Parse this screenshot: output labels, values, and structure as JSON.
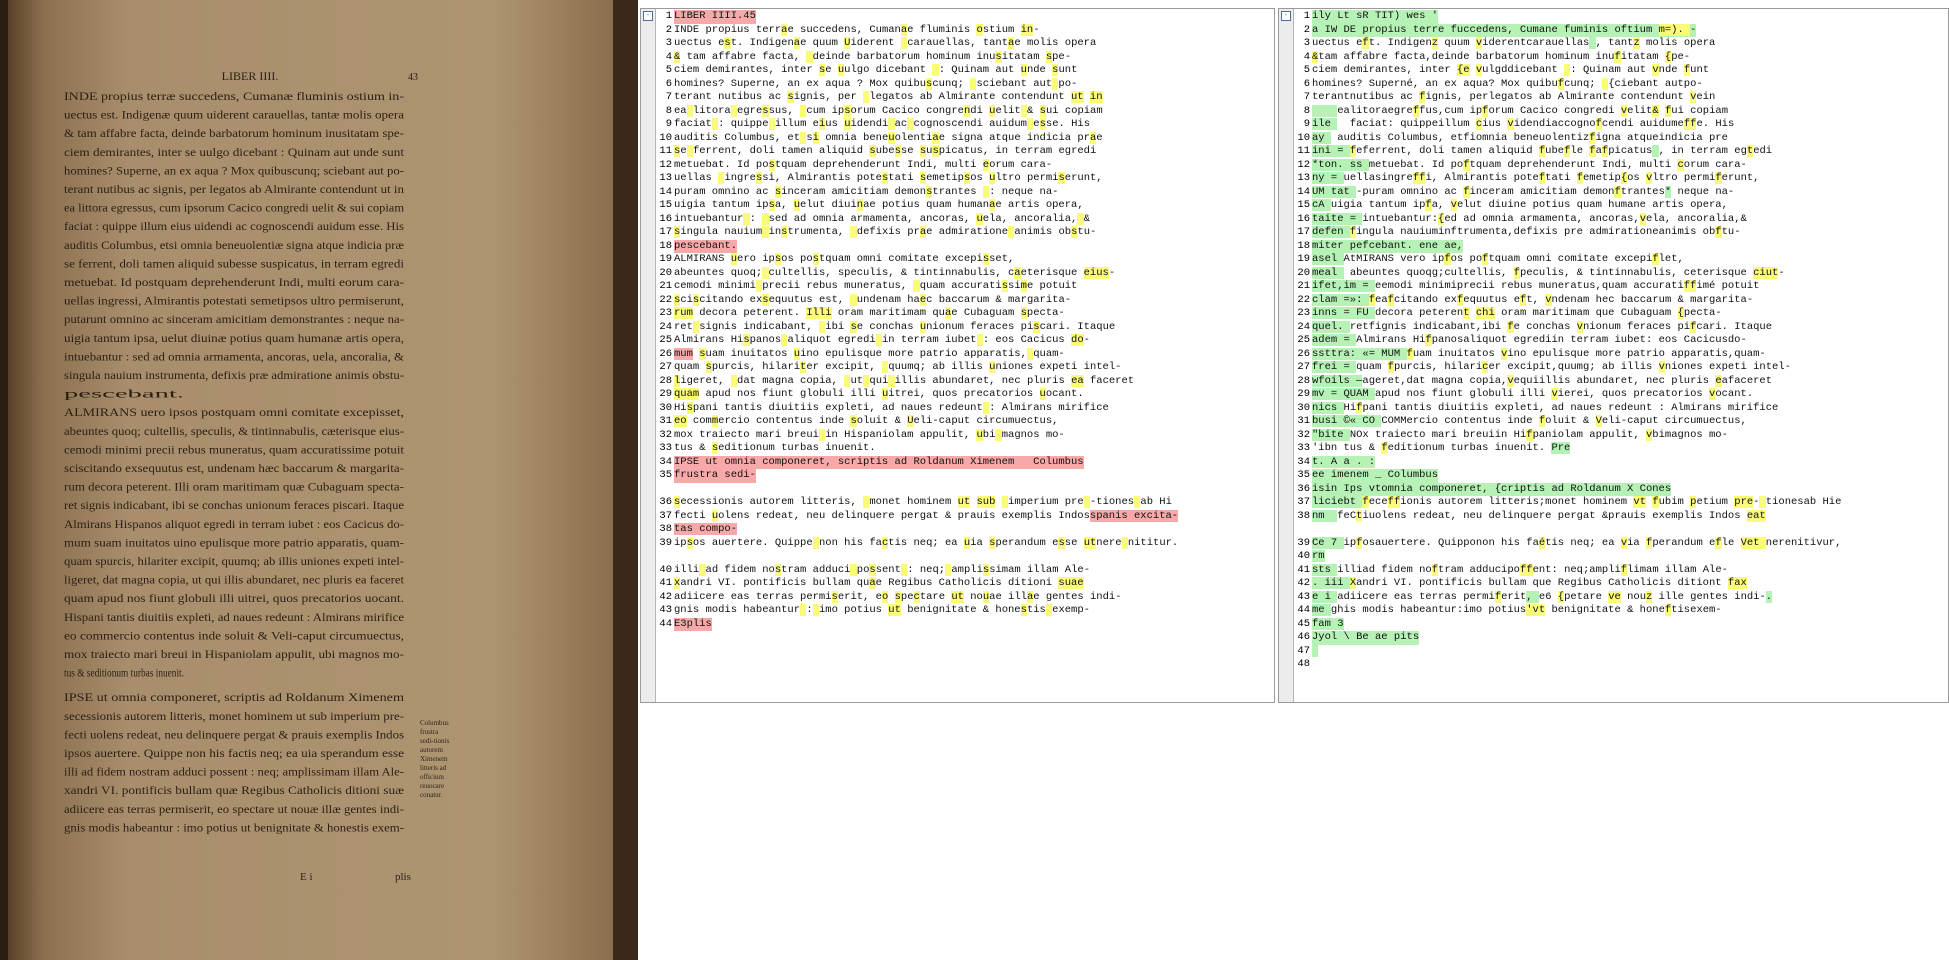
{
  "app": {
    "accent_colors": {
      "diff_word": "#fbfb7a",
      "removed_line": "#f7a8a8",
      "added_line": "#b6f2b6"
    }
  },
  "scan": {
    "lines": [
      "LIBER IIII.",
      "INDE propius terræ succedens, Cumanæ fluminis ostium in-",
      "uectus est. Indigenæ quum uiderent carauellas, tantæ molis opera",
      "& tam affabre facta, deinde barbatorum hominum inusitatam spe-",
      "ciem demirantes, inter se uulgo dicebant : Quinam aut unde sunt",
      "homines? Superne, an ex aqua ? Mox quibuscunq; sciebant aut po-",
      "terant nutibus ac signis, per legatos ab Almirante contendunt ut in",
      "ea littora egressus, cum ipsorum Cacico congredi uelit & sui copiam",
      "faciat : quippe illum eius uidendi ac cognoscendi auidum esse. His",
      "auditis Columbus, etsi omnia beneuolentiæ signa atque indicia præ",
      "se ferrent, doli tamen aliquid subesse suspicatus, in terram egredi",
      "metuebat. Id postquam deprehenderunt Indi, multi eorum cara-",
      "uellas ingressi, Almirantis potestati semetipsos ultro permiserunt,",
      "putarunt omnino ac sinceram amicitiam demonstrantes : neque na-",
      "uigia tantum ipsa, uelut diuinæ potius quam humanæ artis opera,",
      "intuebantur : sed ad omnia armamenta, ancoras, uela, ancoralia, &",
      "singula nauium instrumenta, defixis præ admiratione animis obstu-",
      "pescebant.",
      "ALMIRANS uero ipsos postquam omni comitate excepisset,",
      "abeuntes quoq; cultellis, speculis, & tintinnabulis, cæterisque eius-",
      "cemodi minimi precii rebus muneratus, quam accuratissime potuit",
      "sciscitando exsequutus est, undenam hæc baccarum & margarita-",
      "rum decora peterent. Illi oram maritimam quæ Cubaguam specta-",
      "ret signis indicabant, ibi se conchas unionum feraces piscari. Itaque",
      "Almirans Hispanos aliquot egredi in terram iubet : eos Cacicus do-",
      "mum suam inuitatos uino epulisque more patrio apparatis, quam-",
      "quam spurcis, hilariter excipit, quumq; ab illis uniones expeti intel-",
      "ligeret, dat magna copia, ut qui illis abundaret, nec pluris ea faceret",
      "quam apud nos fiunt globuli illi uitrei, quos precatorios uocant.",
      "Hispani tantis diuitiis expleti, ad naues redeunt : Almirans mirifice",
      "eo commercio contentus inde soluit & Veli-caput circumuectus,",
      "mox traiecto mari breui in Hispaniolam appulit, ubi magnos mo-",
      "tus & seditionum turbas inuenit.",
      "IPSE ut omnia componeret, scriptis ad Roldanum Ximenem",
      "secessionis autorem litteris, monet hominem ut sub imperium pre-",
      "fecti uolens redeat, neu delinquere pergat & prauis exemplis Indos",
      "ipsos auertere. Quippe non his factis neq; ea uia sperandum esse",
      "illi ad fidem nostram adduci possent : neq; amplissimam illam Ale-",
      "xandri VI. pontificis bullam quæ Regibus Catholicis ditioni suæ",
      "adiicere eas terras permiserit, eo spectare ut nouæ illæ gentes indi-",
      "gnis modis habeantur : imo potius ut benignitate & honestis exem-"
    ],
    "page_number": "43",
    "catchword": "plis",
    "signature": "E i",
    "margin_note": "Columbus frustra sedi-tionis autorem Ximenem litteris ad officium reuocare conatur."
  },
  "left_pane": {
    "fold": "-",
    "rows": [
      {
        "n": "1",
        "t": "LIBER IIII.45",
        "hl": "red"
      },
      {
        "n": "2",
        "t": "INDE propius terr[y:a]e succedens, Cuman[y:a]e fluminis [y:o]stium [y:in]-"
      },
      {
        "n": "3",
        "t": "uectus e[y:s]t. Indigen[y:a]e quum [y:U]iderent [y: ]carauellas, tant[y:a]e molis opera"
      },
      {
        "n": "4",
        "t": "[y:&] tam affabre facta, [y: ]deinde barbatorum hominum inu[y:s]itatam [y:s]pe-"
      },
      {
        "n": "5",
        "t": "ciem demirantes, inter [y:s]e [y:u]ulgo dicebant [y: ]: Quinam aut [y:u]nde [y:s]unt"
      },
      {
        "n": "6",
        "t": "homines? Superne, an ex aqua ? Mox quibu[y:s]cunq; [y: ]sciebant aut[y: ]po-"
      },
      {
        "n": "7",
        "t": "terant nutibus ac [y:s]ignis, per [y: ]legatos ab Almirante contendunt [y:ut] [y:in]"
      },
      {
        "n": "8",
        "t": "ea[y: ]litora[y: ]egre[y:s]sus, [y: ]cum ip[y:s]orum Cacico congre[y:n]di [y:u]elit[y: ]& [y:s]ui copiam"
      },
      {
        "n": "9",
        "t": "faciat[y: ]: quippe[y: ]illum e[y:i]us [y:u]idendi[y: ]ac[y: ]cognoscendi auidum[y: ]e[y:s]se. His"
      },
      {
        "n": "10",
        "t": "auditis Columbus, et[y: ]s[y:i] omnia bene[y:u]olenti[y:a]e signa atque indicia pr[y:a]e"
      },
      {
        "n": "11",
        "t": "[y:s]e[y: ]ferrent, doli tamen aliquid [y:s]ube[y:s]se [y:s]u[y:s]picatus, in terram egredi"
      },
      {
        "n": "12",
        "t": "metuebat. Id po[y:s]tquam deprehenderunt Indi, multi [y:e]orum cara-"
      },
      {
        "n": "13",
        "t": "uellas [y: ]ingre[y:s]si, Almirantis pote[y:s]tati [y:s]emetip[y:s]os [y:u]ltro permi[y:s]erunt,"
      },
      {
        "n": "14",
        "t": "puram omnino ac [y:s]inceram amicitiam demon[y:s]trantes [y: ]: neque na-"
      },
      {
        "n": "15",
        "t": "uigia tantum ip[y:s]a, [y:u]elut diui[y:n]ae potius quam human[y:a]e artis opera,"
      },
      {
        "n": "16",
        "t": "intuebantur[y: ]: [y: ]sed ad omnia armamenta, ancoras, [y:u]ela, ancoralia,[y: ]&"
      },
      {
        "n": "17",
        "t": "[y:s]ingula nauium[y: ]in[y:s]trumenta, [y: ]defixis pr[y:a]e admiratione[y: ]animis ob[y:s]tu-"
      },
      {
        "n": "18",
        "t": "pescebant.",
        "hl": "red"
      },
      {
        "n": "19",
        "t": "ALMIRANS [y:u]ero ip[y:s]os po[y:s]tquam omni comitate excepi[y:s]set,"
      },
      {
        "n": "20",
        "t": "abeuntes quoq;[y: ]cultellis, speculis, & tintinnabulis, c[y:a]eterisque [y:eius]-"
      },
      {
        "n": "21",
        "t": "cemodi minimi[y: ]precii rebus muneratus, [y: ]quam accurati[y:s]si[y:m]e potuit"
      },
      {
        "n": "22",
        "t": "[y:s]ci[y:s]citando ex[y:s]equutus est, [y: ]undenam ha[y:e]c baccarum & margarita-"
      },
      {
        "n": "23",
        "t": "[y:rum] decora peterent. [y:Illi] oram maritimam qu[y:a]e Cubaguam [y:s]pecta-"
      },
      {
        "n": "24",
        "t": "ret[y: ]signis indicabant, [y: ]ibi [y:s]e conchas [y:u]nionum feraces pi[y:s]cari. Itaque"
      },
      {
        "n": "25",
        "t": "Almirans Hi[y:s]panos[y: ]aliquot egredi[y: ]in terram iubet[y: ]: eos Cacicus [y:do]-"
      },
      {
        "n": "26",
        "t": "[r:mum] [y:s]uam inuitatos [y:u]ino epulisque more patrio apparatis,[y: ]quam-"
      },
      {
        "n": "27",
        "t": "quam [y:s]purcis, hilari[y:t]er excipit, [y: ]quumq; ab illis [y:u]niones expeti intel-"
      },
      {
        "n": "28",
        "t": "[y:l]igeret, [y: ]dat magna copia, [y: ]ut[y: ]qui[y: ]illis abundaret, nec pluris [y:ea] faceret"
      },
      {
        "n": "29",
        "t": "[y:quam] apud nos fiunt globuli illi [y:u]itrei, quos precatorios [y:u]ocant."
      },
      {
        "n": "30",
        "t": "Hi[y:s]pani tantis diuitiis expleti, ad naues redeunt[y: ]: Almirans mirifice"
      },
      {
        "n": "31",
        "t": "[y:eo] com[y:m]ercio contentus inde [y:s]oluit & [y:U]eli-caput circumuectus,"
      },
      {
        "n": "32",
        "t": "mox traiecto mari breui[y: ]in Hispaniolam appulit, [y:u]bi[y: ]magnos mo-"
      },
      {
        "n": "33",
        "t": "tus & [y:s]editionum turbas inuenit."
      },
      {
        "n": "34",
        "t": "IPSE ut omnia componeret, scriptis ad Roldanum Ximenem   Columbus",
        "hl": "red"
      },
      {
        "n": "35",
        "t": "frustra sedi-",
        "hl": "red"
      },
      {
        "n": "",
        "t": ""
      },
      {
        "n": "36",
        "t": "[y:s]ecessionis autorem litteris, [y: ]monet hominem [y:ut] [y:sub] [y: ]imperium pre[y: ]-tiones[y: ]ab Hi"
      },
      {
        "n": "37",
        "t": "fecti [y:u]olens redeat, neu delinquere pergat & prauis exemplis Indos[r:spanis excita-]"
      },
      {
        "n": "38",
        "t": "[r:tas compo-]"
      },
      {
        "n": "39",
        "t": "ip[y:s]os auertere. Quippe[y: ]non his fa[y:c]tis neq; ea [y:u]ia [y:s]perandum e[y:s]se [y:ut]nere[y: ]nititur."
      },
      {
        "n": "",
        "t": ""
      },
      {
        "n": "40",
        "t": "illi[y: ]ad fidem no[y:s]tram adduci[y: ]po[y:s]sent[y: ]: neq;[y: ]ampli[y:s]simam illam Ale-"
      },
      {
        "n": "41",
        "t": "[y:x]andri VI. pontificis bullam qu[y:a]e Regibus Catholicis ditioni [y:suae]"
      },
      {
        "n": "42",
        "t": "adiicere eas terras permi[y:s]erit, e[y:o] [y:s]pe[y:c]tare [y:ut] no[y:u]ae ill[y:a]e gentes indi-"
      },
      {
        "n": "43",
        "t": "gnis modis habeantur[y: ]:[y: ]imo potius [y:ut] benignitate & hone[y:s]tis[y: ]exemp-"
      },
      {
        "n": "44",
        "t": "E3plis",
        "hl": "red"
      }
    ]
  },
  "right_pane": {
    "fold": "-",
    "rows": [
      {
        "n": "1",
        "t": "ily Lt sR TIT) wes '",
        "hl": "grn"
      },
      {
        "n": "2",
        "t": "a IW DE propius terre fuccedens, Cumane fuminis oftium [y:m=). ]-",
        "hl": "grn"
      },
      {
        "n": "3",
        "t": "uectus e[y:f]t. Indigen[y:z] quum [y:v]iderentcarauellas[g: ], tant[y:z] molis opera"
      },
      {
        "n": "4",
        "t": "[y:&]tam affabre facta,deinde barbatorum hominum inu[y:f]itatam [y:{]pe-"
      },
      {
        "n": "5",
        "t": "ciem demirantes, inter [y:{e] [y:v]ulgddicebant [y: ]: Quinam aut [y:v]nde [y:f]unt"
      },
      {
        "n": "6",
        "t": "homines? Superné, an ex aqua? Mox quibu[y:f]cunq; [y: ]{ciebant autpo-"
      },
      {
        "n": "7",
        "t": "terantnutibus ac [y:f]ignis, perlegatos ab Almirante contendunt [y:v]ein"
      },
      {
        "n": "8",
        "t": "[g:    ]ealitoraegre[y:f]fus,cum ip[y:f]orum Cacico congredi [y:v]elit[y:&] [y:f]ui copiam"
      },
      {
        "n": "9",
        "t": "[g:ile ]  faciat: quippeillum [y:c]ius [y:v]idendiaccogno[y:f]cendi auidume[y:ff]e. His"
      },
      {
        "n": "10",
        "t": "[g:ay ] auditis Columbus, etfiomnia beneuolentiz[y:f]igna atqueindicia pre"
      },
      {
        "n": "11",
        "t": "[g:ini = ][y:f]eferrent, doli tamen aliquid [y:f]ube[y:f]le [y:f]a[y:f]picatus[g: ], in terram eg[y:t]edi"
      },
      {
        "n": "12",
        "t": "[g:*ton. ss ]metuebat. Id po[y:f]tquam deprehenderunt Indi, multi [y:c]orum cara-"
      },
      {
        "n": "13",
        "t": "[g:ny = ]uellasingre[y:ff]i, Almirantis pote[y:f]tati [y:f]emetip[y:{]os [y:v]ltro permi[y:f]erunt,"
      },
      {
        "n": "14",
        "t": "[g:UM tat ]-puram omnino ac [y:f]inceram amicitiam demon[y:f]trantes[g:*] neque na-"
      },
      {
        "n": "15",
        "t": "[g:cA ]uigia tantum ip[y:f]a, [y:v]elut diuine potius quam humane artis opera,"
      },
      {
        "n": "16",
        "t": "[g:taite = ]intuebantur:[y:{]ed ad omnia armamenta, ancoras,[y:v]ela, ancoralia,&"
      },
      {
        "n": "17",
        "t": "[g:defen ][y:f]ingula nauiuminftrumenta,defixis pre admirationeanimis ob[y:f]tu-"
      },
      {
        "n": "18",
        "t": "miter pefcebant. ene ae,",
        "hl": "grn"
      },
      {
        "n": "19",
        "t": "[g:asel ]AtMIRANS vero ip[y:f]os po[y:f]tquam omni comitate excepi[y:f]let,"
      },
      {
        "n": "20",
        "t": "[g:meal ] abeuntes quoqg;cultellis, [y:f]peculis, & tintinnabulis, ceterisque [y:ciut]-"
      },
      {
        "n": "21",
        "t": "[g:ifet,im = ]eemodi minimiprecii rebus muneratus,quam accurati[y:ff]imé potuit"
      },
      {
        "n": "22",
        "t": "[g:clam =»: ][y:f]ea[y:f]citando ex[y:f]equutus e[y:f]t, [y:v]ndenam hec baccarum & margarita-"
      },
      {
        "n": "23",
        "t": "[g:inns = FU ]decora peteren[y:t] [y:chi] oram maritimam que Cubaguam [y:{]pecta-"
      },
      {
        "n": "24",
        "t": "[g:quel. ]retfignis indicabant,ibi [y:f]e conchas [y:v]nionum feraces pi[y:f]cari. Itaque"
      },
      {
        "n": "25",
        "t": "[g:adem = ]Almirans Hi[y:f]panosaliquot egrediin terram iubet: eos Cacicusdo-"
      },
      {
        "n": "26",
        "t": "[g:ssttra: «= MUM ][y:f]uam inuitatos [y:v]ino epulisque more patrio apparatis,quam-"
      },
      {
        "n": "27",
        "t": "[g:frei = ]quam [y:f]purcis, hilari[y:c]er excipit,quumg; ab illis [y:v]niones expeti intel-"
      },
      {
        "n": "28",
        "t": "[g:wfoils —]ageret,dat magna copia,[y:v]equiillis abundaret, nec pluris [y:e]afaceret"
      },
      {
        "n": "29",
        "t": "[g:mv = QUAM ]apud nos fiunt globuli illi [y:v]ierei, quos precatorios [y:v]ocant."
      },
      {
        "n": "30",
        "t": "[g:nics ]Hi[y:f]pani tantis diuitiis expleti, ad naues redeunt : Almirans mirifice"
      },
      {
        "n": "31",
        "t": "[g:busi ©« CO ]COMMercio contentus inde [y:f]oluit & [y:V]eli-caput circumuectus,"
      },
      {
        "n": "32",
        "t": "[g:\"bite ]NOx traiecto mari breuiin Hi[y:f]paniolam appulit, [y:v]bimagnos mo-"
      },
      {
        "n": "33",
        "t": "'ibn tus & [y:f]editionum turbas inuenit. [g:Pre]"
      },
      {
        "n": "34",
        "t": "[g:t. A a . :]"
      },
      {
        "n": "35",
        "t": "ee imenem _ Columbus",
        "hl": "grn"
      },
      {
        "n": "36",
        "t": "isin Ips vtomnia componeret, {criptis ad Roldanum X Cones",
        "hl": "grn"
      },
      {
        "n": "37",
        "t": "[g:liciebt ][y:f]ece[y:ff]ionis autorem litteris;monet hominem [y:vt] [y:f]ubim [y:p]etium [y:pre]-[y: ]tionesab Hie"
      },
      {
        "n": "38",
        "t": "[g:nm  ]feC[y:t]iuolens redeat, neu delinquere pergat &prauis exemplis Indos [y:eat]"
      },
      {
        "n": "",
        "t": ""
      },
      {
        "n": "39",
        "t": "[g:Ce 7 ]ip[y:f]osauertere. Quipponon his fa[y:é]tis neq; ea [y:v]ia [y:f]perandum e[y:f]le [y:Vet ]nerenitivur,"
      },
      {
        "n": "40",
        "t": "[g:rm]"
      },
      {
        "n": "41",
        "t": "[g:sts ]illiad fidem no[y:f]tram adducipo[y:ff]ent: neq;ampli[y:f]limam illam Ale-"
      },
      {
        "n": "42",
        "t": "[g:. iii ][y:X]andri VI. pontificis bullam que Regibus Catholicis ditiont [y:fax]"
      },
      {
        "n": "43",
        "t": "[g:e i ]adiicere eas terras permi[y:f]erit[g:, ]e6 [y:{]petare [y:ve] nou[y:z] ille gentes indi-[g:.]"
      },
      {
        "n": "44",
        "t": "[g:me ]ghis modis habeantur:imo potius[y:'vt] benignitate & hone[y:f]tisexem-"
      },
      {
        "n": "45",
        "t": "[g:fam 3]"
      },
      {
        "n": "46",
        "t": "Jyol \\ Be ae pits",
        "hl": "grn"
      },
      {
        "n": "47",
        "t": "[g: ]"
      },
      {
        "n": "48",
        "t": ""
      }
    ]
  }
}
